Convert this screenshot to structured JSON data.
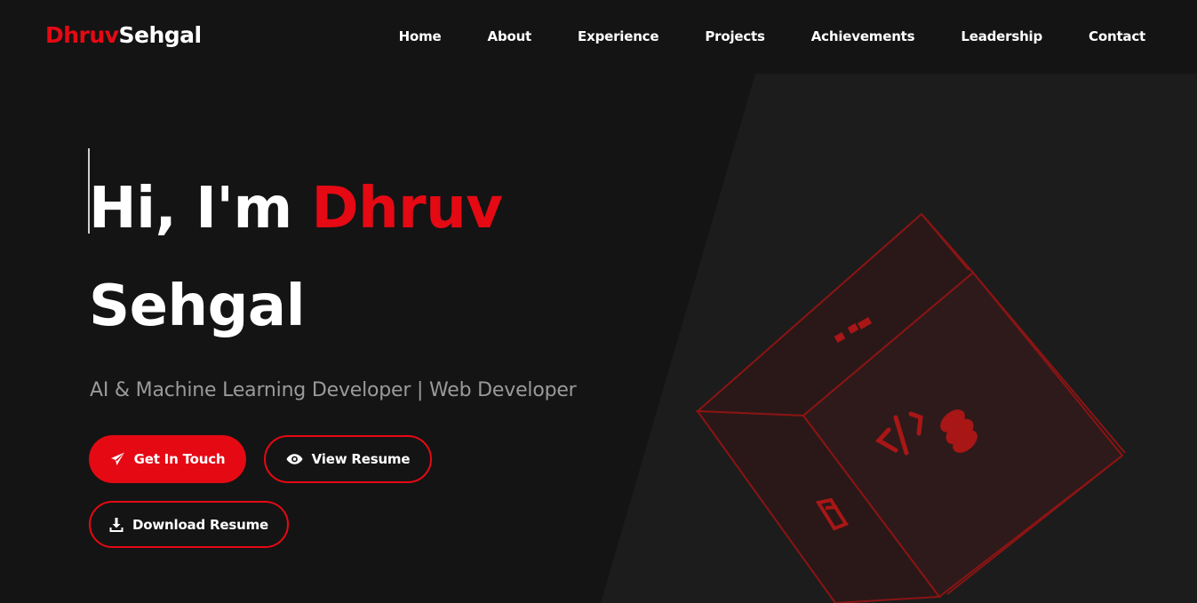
{
  "logo": {
    "first": "Dhruv",
    "last": "Sehgal"
  },
  "nav": {
    "items": [
      "Home",
      "About",
      "Experience",
      "Projects",
      "Achievements",
      "Leadership",
      "Contact"
    ]
  },
  "hero": {
    "greeting": "Hi, I'm ",
    "name_first": "Dhruv",
    "name_last": "Sehgal",
    "subtitle": "AI & Machine Learning Developer | Web Developer"
  },
  "buttons": {
    "contact": "Get In Touch",
    "view_resume": "View Resume",
    "download_resume": "Download Resume"
  },
  "colors": {
    "accent": "#e50914",
    "background": "#141414",
    "panel": "#1c1c1c"
  },
  "icons": {
    "contact": "paper-plane-icon",
    "view_resume": "eye-icon",
    "download_resume": "download-icon",
    "cube_front": "code-icon",
    "cube_db": "database-icon",
    "cube_top": "sitemap-icon",
    "cube_side": "html5-icon"
  }
}
